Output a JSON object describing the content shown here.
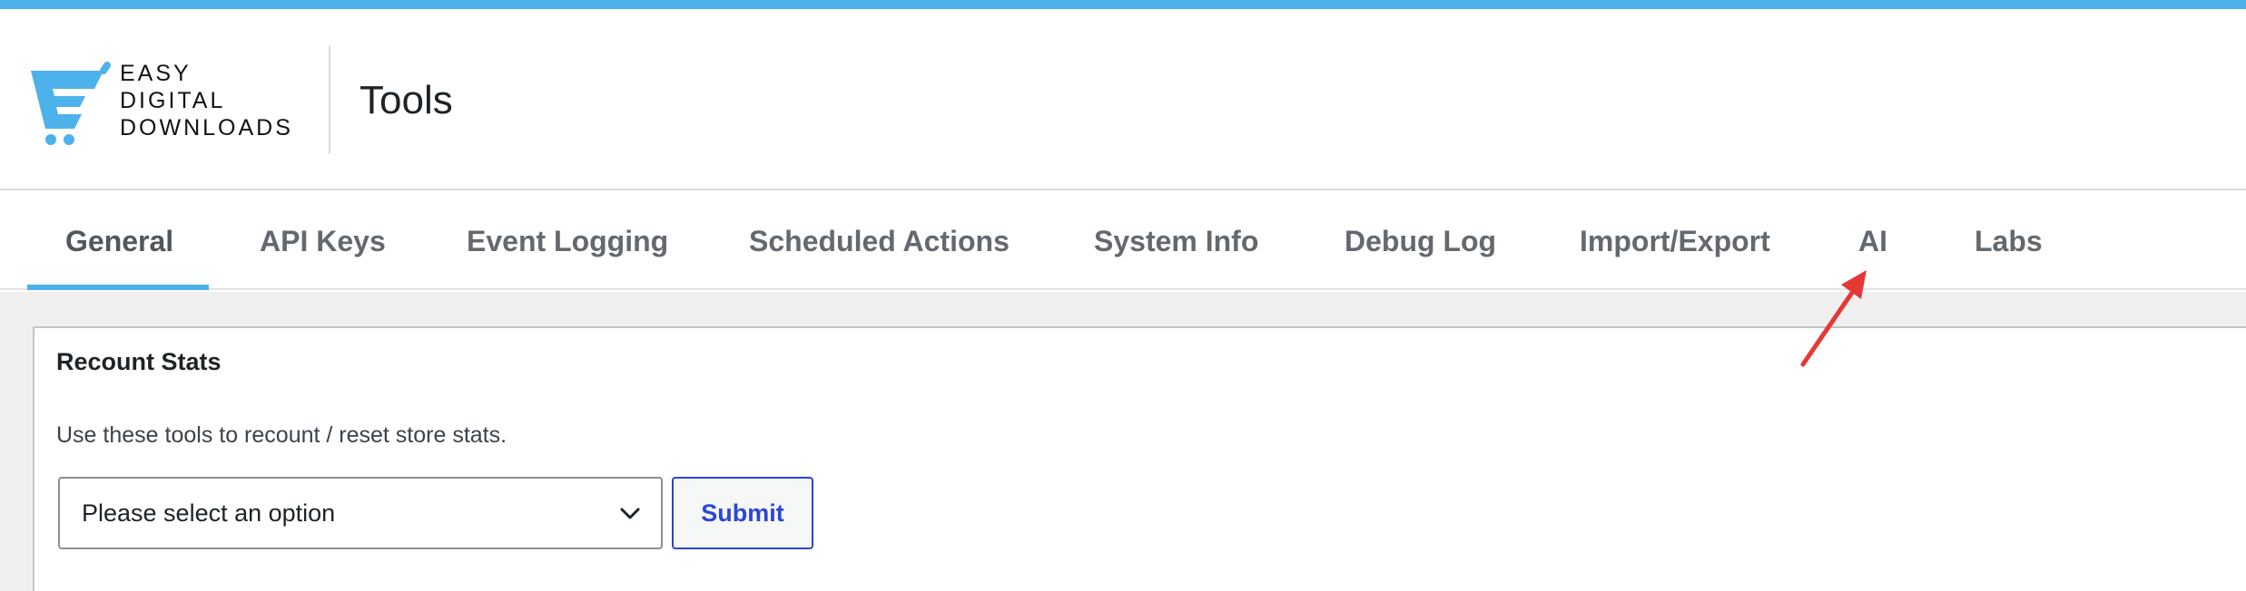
{
  "app": {
    "brand_lines": [
      "EASY",
      "DIGITAL",
      "DOWNLOADS"
    ],
    "page_title": "Tools",
    "brand_color": "#4db2ec"
  },
  "tabs": [
    {
      "label": "General",
      "active": true
    },
    {
      "label": "API Keys",
      "active": false
    },
    {
      "label": "Event Logging",
      "active": false
    },
    {
      "label": "Scheduled Actions",
      "active": false
    },
    {
      "label": "System Info",
      "active": false
    },
    {
      "label": "Debug Log",
      "active": false
    },
    {
      "label": "Import/Export",
      "active": false
    },
    {
      "label": "AI",
      "active": false
    },
    {
      "label": "Labs",
      "active": false
    }
  ],
  "recount": {
    "title": "Recount Stats",
    "description": "Use these tools to recount / reset store stats.",
    "select_value": "Please select an option",
    "submit_label": "Submit"
  },
  "annotation": {
    "arrow_color": "#e53935",
    "points_to": "AI"
  },
  "icons": {
    "logo": "easy-digital-downloads-cart-logo",
    "select": "chevron-down-icon",
    "annotation": "red-arrow-icon"
  }
}
